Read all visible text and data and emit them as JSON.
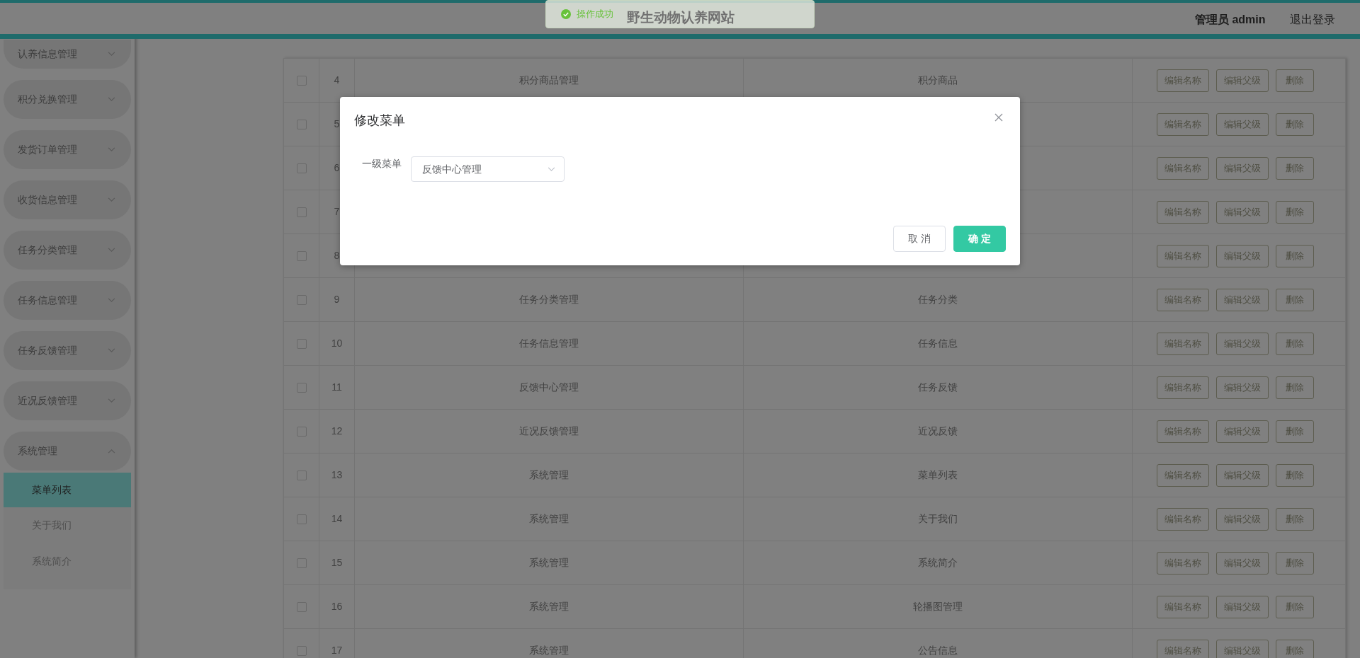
{
  "header": {
    "title": "野生动物认养网站",
    "user": "管理员 admin",
    "logout": "退出登录"
  },
  "toast": {
    "kind": "success",
    "message": "操作成功"
  },
  "sidebar": {
    "items": [
      {
        "label": "认养信息管理",
        "expanded": false
      },
      {
        "label": "积分兑换管理",
        "expanded": false
      },
      {
        "label": "发货订单管理",
        "expanded": false
      },
      {
        "label": "收货信息管理",
        "expanded": false
      },
      {
        "label": "任务分类管理",
        "expanded": false
      },
      {
        "label": "任务信息管理",
        "expanded": false
      },
      {
        "label": "任务反馈管理",
        "expanded": false
      },
      {
        "label": "近况反馈管理",
        "expanded": false
      },
      {
        "label": "系统管理",
        "expanded": true,
        "children": [
          {
            "label": "菜单列表",
            "selected": true
          },
          {
            "label": "关于我们",
            "selected": false
          },
          {
            "label": "系统简介",
            "selected": false
          }
        ]
      }
    ]
  },
  "table": {
    "rows": [
      {
        "checked": false,
        "index": "4",
        "parent": "积分商品管理",
        "name": "积分商品",
        "actions": [
          "编辑名称",
          "编辑父级",
          "删除"
        ]
      },
      {
        "checked": false,
        "index": "5",
        "actions": [
          "编辑名称",
          "编辑父级",
          "删除"
        ]
      },
      {
        "checked": false,
        "index": "6",
        "actions": [
          "编辑名称",
          "编辑父级",
          "删除"
        ]
      },
      {
        "checked": false,
        "index": "7",
        "actions": [
          "编辑名称",
          "编辑父级",
          "删除"
        ]
      },
      {
        "checked": false,
        "index": "8",
        "actions": [
          "编辑名称",
          "编辑父级",
          "删除"
        ]
      },
      {
        "checked": false,
        "index": "9",
        "parent": "任务分类管理",
        "name": "任务分类",
        "actions": [
          "编辑名称",
          "编辑父级",
          "删除"
        ]
      },
      {
        "checked": false,
        "index": "10",
        "parent": "任务信息管理",
        "name": "任务信息",
        "actions": [
          "编辑名称",
          "编辑父级",
          "删除"
        ]
      },
      {
        "checked": false,
        "index": "11",
        "parent": "反馈中心管理",
        "name": "任务反馈",
        "actions": [
          "编辑名称",
          "编辑父级",
          "删除"
        ]
      },
      {
        "checked": false,
        "index": "12",
        "parent": "近况反馈管理",
        "name": "近况反馈",
        "actions": [
          "编辑名称",
          "编辑父级",
          "删除"
        ]
      },
      {
        "checked": false,
        "index": "13",
        "parent": "系统管理",
        "name": "菜单列表",
        "actions": [
          "编辑名称",
          "编辑父级",
          "删除"
        ]
      },
      {
        "checked": false,
        "index": "14",
        "parent": "系统管理",
        "name": "关于我们",
        "actions": [
          "编辑名称",
          "编辑父级",
          "删除"
        ]
      },
      {
        "checked": false,
        "index": "15",
        "parent": "系统管理",
        "name": "系统简介",
        "actions": [
          "编辑名称",
          "编辑父级",
          "删除"
        ]
      },
      {
        "checked": false,
        "index": "16",
        "parent": "系统管理",
        "name": "轮播图管理",
        "actions": [
          "编辑名称",
          "编辑父级",
          "删除"
        ]
      },
      {
        "checked": false,
        "index": "17",
        "parent": "系统管理",
        "name": "公告信息",
        "actions": [
          "编辑名称",
          "编辑父级",
          "删除"
        ]
      }
    ]
  },
  "dialog": {
    "title": "修改菜单",
    "field_label": "一级菜单",
    "select_value": "反馈中心管理",
    "buttons": [
      {
        "kind": "default",
        "label": "取消"
      },
      {
        "kind": "primary",
        "label": "确定"
      }
    ]
  }
}
